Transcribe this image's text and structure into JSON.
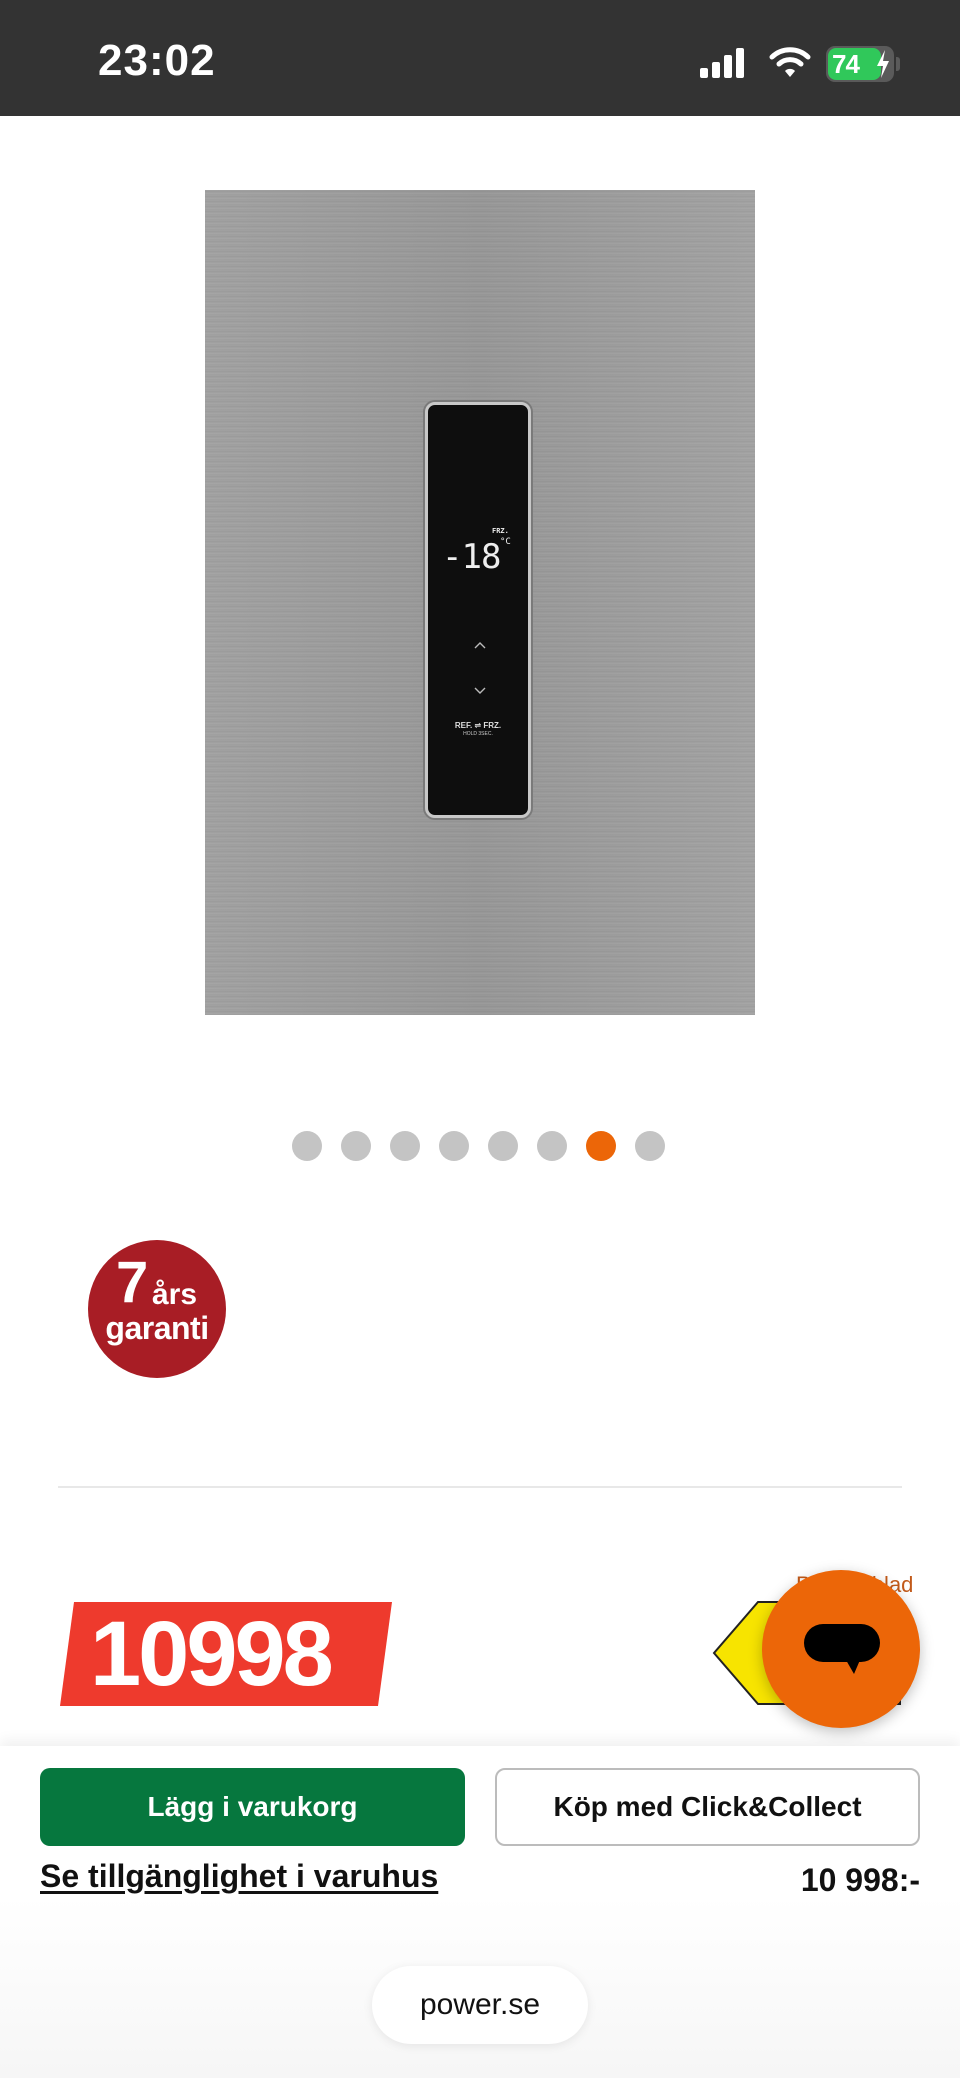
{
  "status_bar": {
    "time": "23:02",
    "battery_percent": "74",
    "icons": [
      "signal-icon",
      "wifi-icon",
      "battery-charging-icon"
    ]
  },
  "product_image": {
    "display_mode": "FRZ.",
    "display_temp": "-18",
    "display_unit": "°C",
    "display_ref_frz": "REF. ⇌ FRZ.",
    "display_hold": "HOLD 3SEC.",
    "gallery": {
      "total": 8,
      "active_index": 6
    }
  },
  "warranty_badge": {
    "years": "7",
    "suffix": "års",
    "label": "garanti"
  },
  "price": {
    "tag": "10998",
    "energy_sheet_label": "Produktblad",
    "energy_class_color": "#f7e400"
  },
  "actions": {
    "add_to_cart": "Lägg i varukorg",
    "click_collect": "Köp med Click&Collect",
    "store_availability": "Se tillgänglighet i varuhus",
    "price_summary": "10 998:-"
  },
  "browser": {
    "url": "power.se"
  },
  "colors": {
    "accent_orange": "#ec6608",
    "cart_green": "#06773e",
    "price_red": "#ee3a2d",
    "warranty_red": "#a81d25"
  }
}
